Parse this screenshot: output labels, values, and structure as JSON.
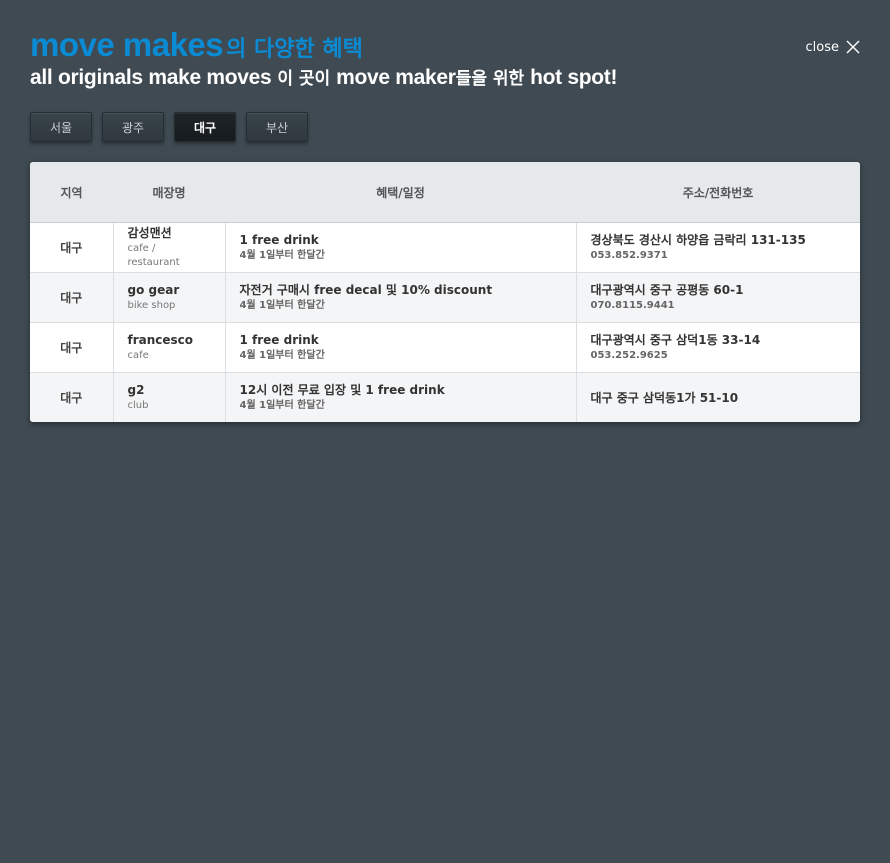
{
  "header": {
    "brand": "move makes",
    "brand_suffix": "의 다양한 혜택",
    "line2_part1": "all originals make moves",
    "line2_part2": " 이 곳이 ",
    "line2_part3": "move maker",
    "line2_part4": "들을 위한 ",
    "line2_part5": "hot spot!",
    "close_label": "close"
  },
  "tabs": [
    {
      "label": "서울",
      "active": false
    },
    {
      "label": "광주",
      "active": false
    },
    {
      "label": "대구",
      "active": true
    },
    {
      "label": "부산",
      "active": false
    }
  ],
  "table": {
    "headers": {
      "region": "지역",
      "store": "매장명",
      "benefit": "혜택/일정",
      "address": "주소/전화번호"
    },
    "rows": [
      {
        "region": "대구",
        "store": "감성맨션",
        "store_type": "cafe / restaurant",
        "benefit": "1 free drink",
        "schedule": "4월 1일부터 한달간",
        "address": "경상북도 경산시 하양읍 금락리 131-135",
        "phone": "053.852.9371"
      },
      {
        "region": "대구",
        "store": "go gear",
        "store_type": "bike shop",
        "benefit": "자전거 구매시 free decal 및 10% discount",
        "schedule": "4월 1일부터 한달간",
        "address": "대구광역시 중구 공평동 60-1",
        "phone": "070.8115.9441"
      },
      {
        "region": "대구",
        "store": "francesco",
        "store_type": "cafe",
        "benefit": "1 free drink",
        "schedule": "4월 1일부터 한달간",
        "address": "대구광역시 중구 삼덕1동 33-14",
        "phone": "053.252.9625"
      },
      {
        "region": "대구",
        "store": "g2",
        "store_type": "club",
        "benefit": "12시 이전 무료 입장 및 1 free drink",
        "schedule": "4월 1일부터 한달간",
        "address": "대구 중구 삼덕동1가 51-10",
        "phone": ""
      }
    ]
  },
  "colors": {
    "background": "#3f4a52",
    "brand": "#0a8bd4"
  },
  "icons": {
    "close": "close-x-icon"
  }
}
